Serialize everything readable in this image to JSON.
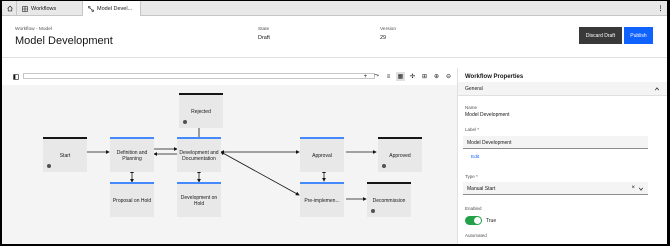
{
  "tabs": [
    {
      "label": "Workflows"
    },
    {
      "label": "Model Devel..."
    }
  ],
  "header": {
    "breadcrumb": "Workflow - Model",
    "title": "Model Development",
    "state_label": "State",
    "state_value": "Draft",
    "version_label": "Version",
    "version_value": "29",
    "discard_label": "Discard Draft",
    "publish_label": "Publish"
  },
  "canvas": {
    "nodes": {
      "rejected": "Rejected",
      "start": "Start",
      "definition": "Definition and Planning",
      "development": "Development and Documentation",
      "approval": "Approval",
      "approved": "Approved",
      "proposal_hold": "Proposal on Hold",
      "development_hold": "Development on Hold",
      "pre_impl": "Pre-implemen...",
      "decommission": "Decommission"
    }
  },
  "panel": {
    "title": "Workflow Properties",
    "section": "General",
    "name_label": "Name",
    "name_value": "Model Development",
    "label_label": "Label *",
    "label_value": "Model Development",
    "edit_label": "Edit",
    "type_label": "Type *",
    "type_value": "Manual Start",
    "enabled_label": "Enabled",
    "enabled_value": "True",
    "automated_label": "Automated"
  },
  "colors": {
    "primary": "#0f62fe",
    "secondary": "#393939",
    "node_border_blue": "#4589ff",
    "toggle_on": "#24a148"
  }
}
